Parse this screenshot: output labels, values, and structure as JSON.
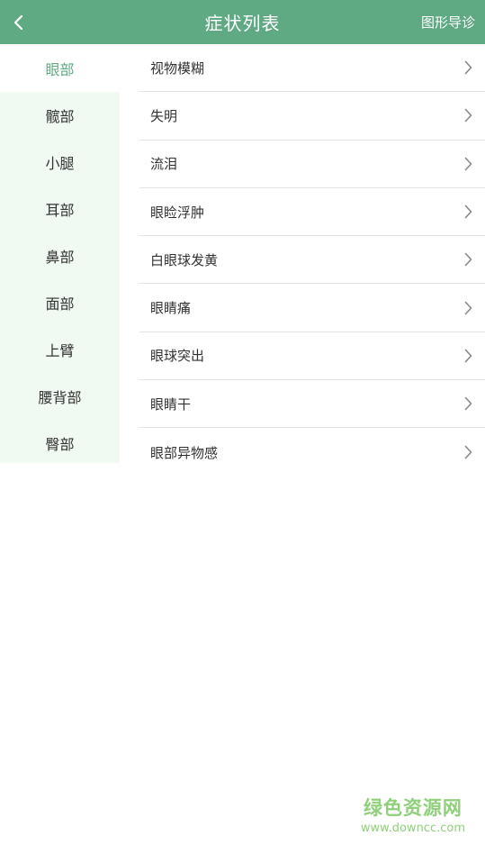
{
  "header": {
    "title": "症状列表",
    "graph_button": "图形导诊"
  },
  "sidebar": {
    "items": [
      {
        "label": "眼部",
        "active": true
      },
      {
        "label": "髋部"
      },
      {
        "label": "小腿"
      },
      {
        "label": "耳部"
      },
      {
        "label": "鼻部"
      },
      {
        "label": "面部"
      },
      {
        "label": "上臂"
      },
      {
        "label": "腰背部"
      },
      {
        "label": "臀部"
      }
    ]
  },
  "symptoms": [
    {
      "label": "视物模糊"
    },
    {
      "label": "失明"
    },
    {
      "label": "流泪"
    },
    {
      "label": "眼睑浮肿"
    },
    {
      "label": "白眼球发黄"
    },
    {
      "label": "眼睛痛"
    },
    {
      "label": "眼球突出"
    },
    {
      "label": "眼睛干"
    },
    {
      "label": "眼部异物感"
    }
  ],
  "watermark": {
    "name": "绿色资源网",
    "url": "www.downcc.com"
  },
  "colors": {
    "primary": "#5fa983",
    "sidebar_bg": "#f1f9f3",
    "watermark": "#8fd07a"
  },
  "icons": {
    "back": "chevron-left-icon",
    "row": "chevron-right-icon"
  }
}
